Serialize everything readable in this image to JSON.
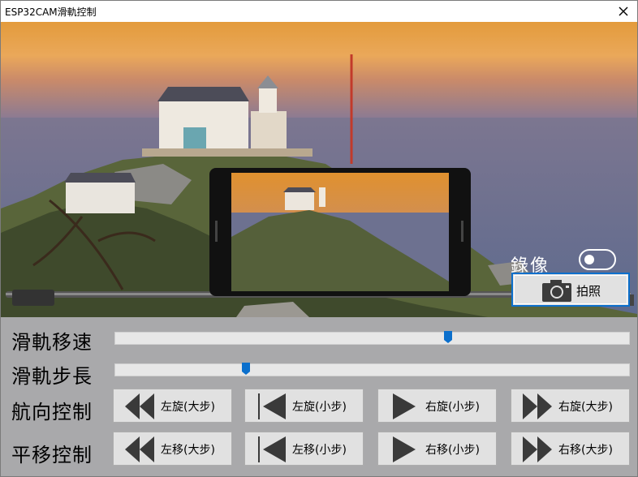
{
  "window": {
    "title": "ESP32CAM滑軌控制",
    "close_icon": "close-icon"
  },
  "camera": {
    "record_label": "錄像",
    "record_toggle_on": false,
    "photo_button_label": "拍照"
  },
  "controls": {
    "speed": {
      "label": "滑軌移速",
      "value_fraction": 0.65
    },
    "step": {
      "label": "滑軌步長",
      "value_fraction": 0.25
    },
    "heading": {
      "label": "航向控制",
      "buttons": [
        "左旋(大步)",
        "左旋(小步)",
        "右旋(小步)",
        "右旋(大步)"
      ]
    },
    "translate": {
      "label": "平移控制",
      "buttons": [
        "左移(大步)",
        "左移(小步)",
        "右移(小步)",
        "右移(大步)"
      ]
    }
  },
  "colors": {
    "accent": "#0b6fcc",
    "panel": "#a9a9ab",
    "button": "#e1e1e1"
  }
}
